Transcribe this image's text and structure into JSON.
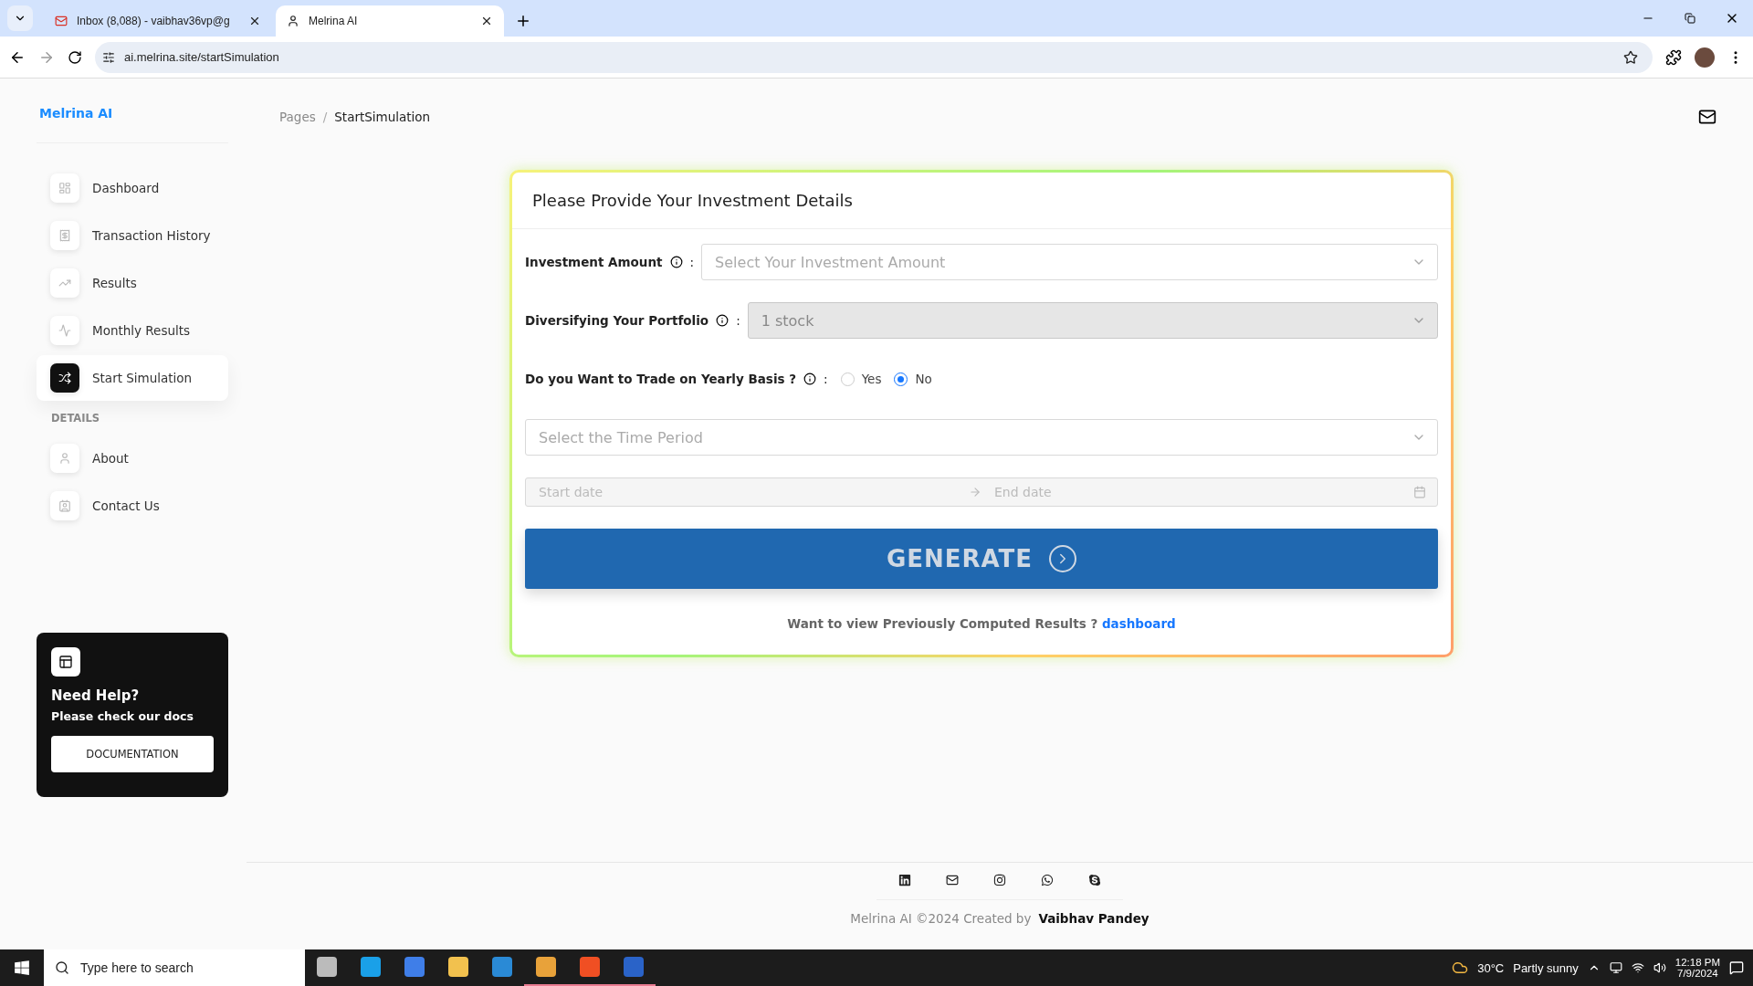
{
  "browser": {
    "tabs": [
      {
        "title": "Inbox (8,088) - vaibhav36vp@g",
        "selected": false
      },
      {
        "title": "Melrina AI",
        "selected": true
      }
    ],
    "url": "ai.melrina.site/startSimulation"
  },
  "sidebar": {
    "brand": "Melrina AI",
    "items": [
      {
        "label": "Dashboard",
        "selected": false
      },
      {
        "label": "Transaction History",
        "selected": false
      },
      {
        "label": "Results",
        "selected": false
      },
      {
        "label": "Monthly Results",
        "selected": false
      },
      {
        "label": "Start Simulation",
        "selected": true
      }
    ],
    "section": "DETAILS",
    "detail_items": [
      {
        "label": "About",
        "selected": false
      },
      {
        "label": "Contact Us",
        "selected": false
      }
    ],
    "help": {
      "title": "Need Help?",
      "subtitle": "Please check our docs",
      "button": "DOCUMENTATION"
    }
  },
  "breadcrumb": {
    "items": [
      "Pages",
      "StartSimulation"
    ],
    "separator": "/"
  },
  "form": {
    "title": "Please Provide Your Investment Details",
    "investment_amount": {
      "label": "Investment Amount",
      "colon": ":",
      "placeholder": "Select Your Investment Amount",
      "disabled": false
    },
    "portfolio": {
      "label": "Diversifying Your Portfolio",
      "colon": ":",
      "value": "1 stock",
      "disabled": true
    },
    "yearly": {
      "label": "Do you Want to Trade on Yearly Basis ?",
      "colon": ":",
      "options": [
        {
          "label": "Yes",
          "selected": false
        },
        {
          "label": "No",
          "selected": true
        }
      ]
    },
    "time_period": {
      "placeholder": "Select the Time Period"
    },
    "date_range": {
      "start_placeholder": "Start date",
      "end_placeholder": "End date"
    },
    "generate_button": "GENERATE",
    "note": {
      "text": "Want to view Previously Computed Results ?",
      "link": "dashboard"
    }
  },
  "footer": {
    "copyright": "Melrina AI ©2024 Created by",
    "author": "Vaibhav Pandey"
  },
  "taskbar": {
    "search_placeholder": "Type here to search",
    "temperature": "30°C",
    "weather": "Partly sunny",
    "time": "12:18 PM",
    "date": "7/9/2024"
  }
}
